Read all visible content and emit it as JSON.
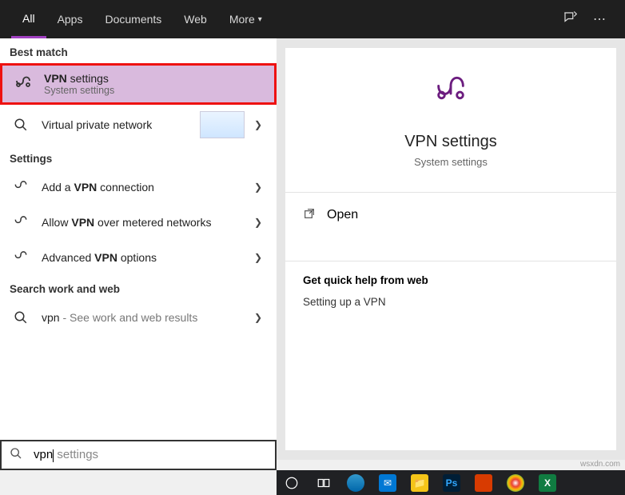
{
  "header": {
    "tabs": [
      "All",
      "Apps",
      "Documents",
      "Web",
      "More"
    ]
  },
  "sections": {
    "best_match": "Best match",
    "settings": "Settings",
    "search_work_web": "Search work and web"
  },
  "results": {
    "vpn_settings": {
      "title_prefix": "VPN",
      "title_suffix": " settings",
      "sub": "System settings"
    },
    "virtual_private": {
      "title": "Virtual private network"
    },
    "add_conn": {
      "pre": "Add a ",
      "bold": "VPN",
      "post": " connection"
    },
    "allow_metered": {
      "pre": "Allow ",
      "bold": "VPN",
      "post": " over metered networks"
    },
    "advanced": {
      "pre": "Advanced ",
      "bold": "VPN",
      "post": " options"
    },
    "web_search": {
      "term": "vpn",
      "hint": " - See work and web results"
    }
  },
  "detail": {
    "title": "VPN settings",
    "sub": "System settings",
    "open": "Open",
    "help_heading": "Get quick help from web",
    "help_link": "Setting up a VPN"
  },
  "search": {
    "value": "vpn",
    "ghost_suffix": " settings"
  },
  "watermark": "wsxdn.com"
}
